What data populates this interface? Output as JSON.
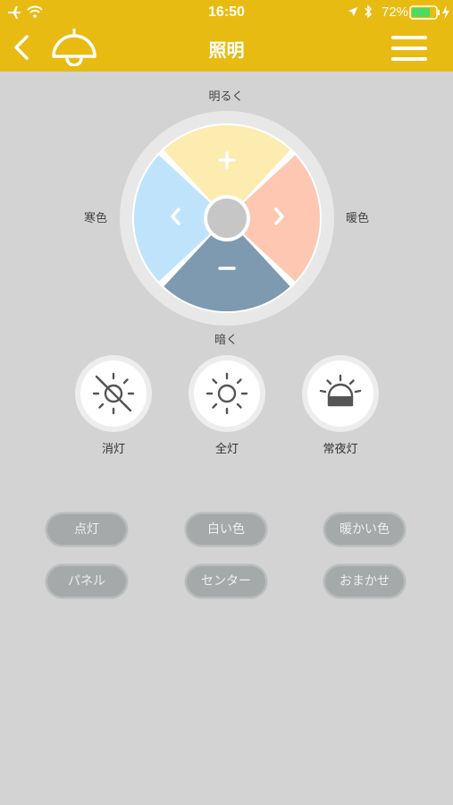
{
  "status_bar": {
    "time": "16:50",
    "battery": "72%"
  },
  "header": {
    "title": "照明"
  },
  "dial": {
    "top_label": "明るく",
    "left_label": "寒色",
    "right_label": "暖色",
    "bottom_label": "暗く",
    "colors": {
      "up": "#fcecb0",
      "right": "#fdc7b2",
      "down": "#7d9ab0",
      "left": "#bfe3fb"
    }
  },
  "modes": [
    {
      "label": "消灯",
      "icon": "sun-off-icon"
    },
    {
      "label": "全灯",
      "icon": "sun-icon"
    },
    {
      "label": "常夜灯",
      "icon": "night-light-icon"
    }
  ],
  "presets": {
    "row1": [
      "点灯",
      "白い色",
      "暖かい色"
    ],
    "row2": [
      "パネル",
      "センター",
      "おまかせ"
    ]
  },
  "theme": {
    "accent": "#e8bb12",
    "background": "#d3d3d3"
  }
}
